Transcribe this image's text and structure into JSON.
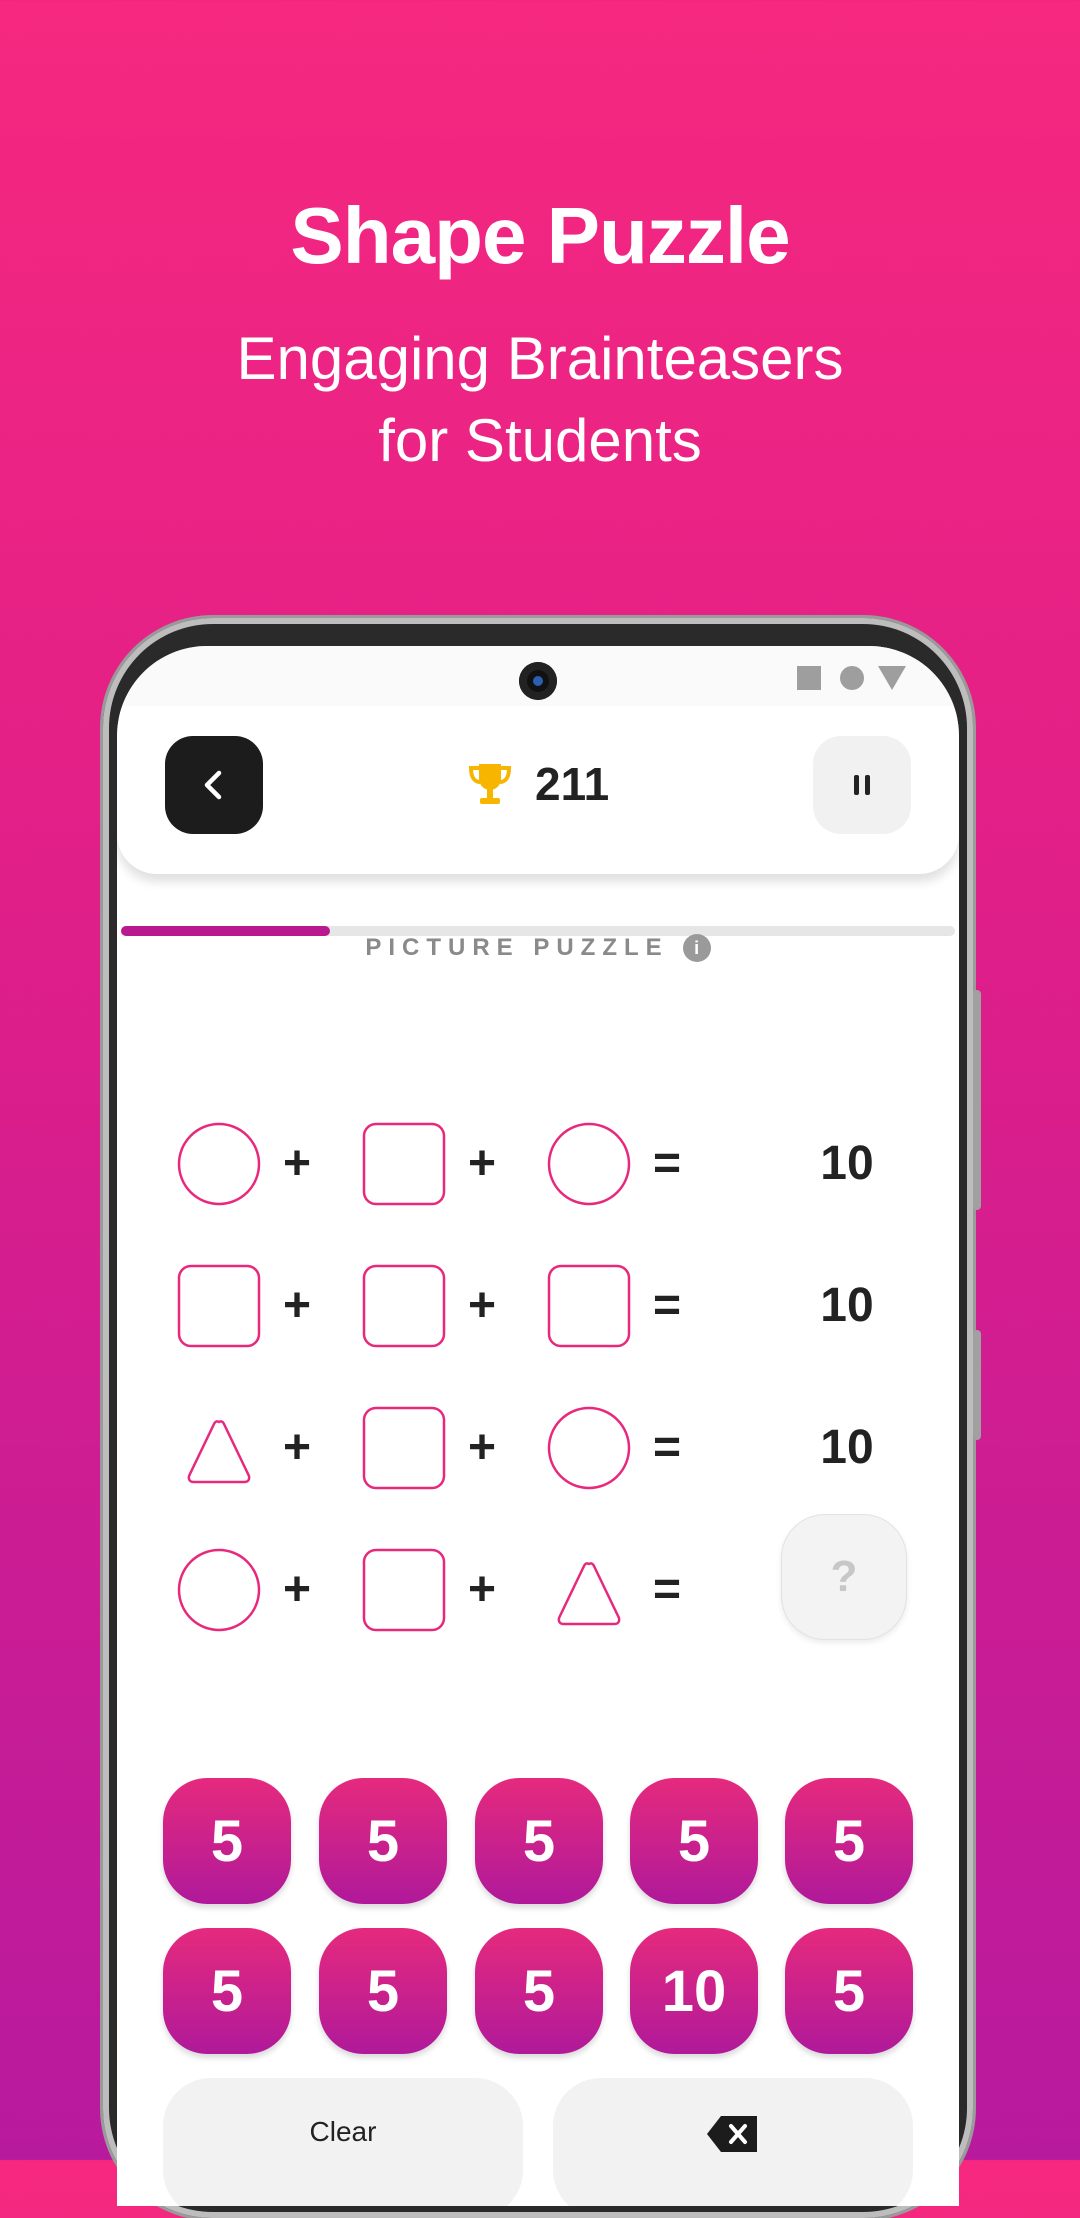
{
  "promo": {
    "title": "Shape Puzzle",
    "subtitle_line1": "Engaging Brainteasers",
    "subtitle_line2": "for Students"
  },
  "header": {
    "score": "211",
    "progress": 0.25
  },
  "puzzle": {
    "label": "PICTURE PUZZLE",
    "info_symbol": "i",
    "plus": "+",
    "equals": "=",
    "rows": [
      {
        "shapes": [
          "circle",
          "square",
          "circle"
        ],
        "result": "10"
      },
      {
        "shapes": [
          "square",
          "square",
          "square"
        ],
        "result": "10"
      },
      {
        "shapes": [
          "triangle",
          "square",
          "circle"
        ],
        "result": "10"
      },
      {
        "shapes": [
          "circle",
          "square",
          "triangle"
        ],
        "result": "?"
      }
    ]
  },
  "keypad": {
    "keys": [
      "5",
      "5",
      "5",
      "5",
      "5",
      "5",
      "5",
      "5",
      "10",
      "5"
    ]
  },
  "actions": {
    "clear_label": "Clear"
  },
  "colors": {
    "accent": "#e8287c",
    "accent_dark": "#b0199a",
    "trophy": "#f7b500"
  }
}
